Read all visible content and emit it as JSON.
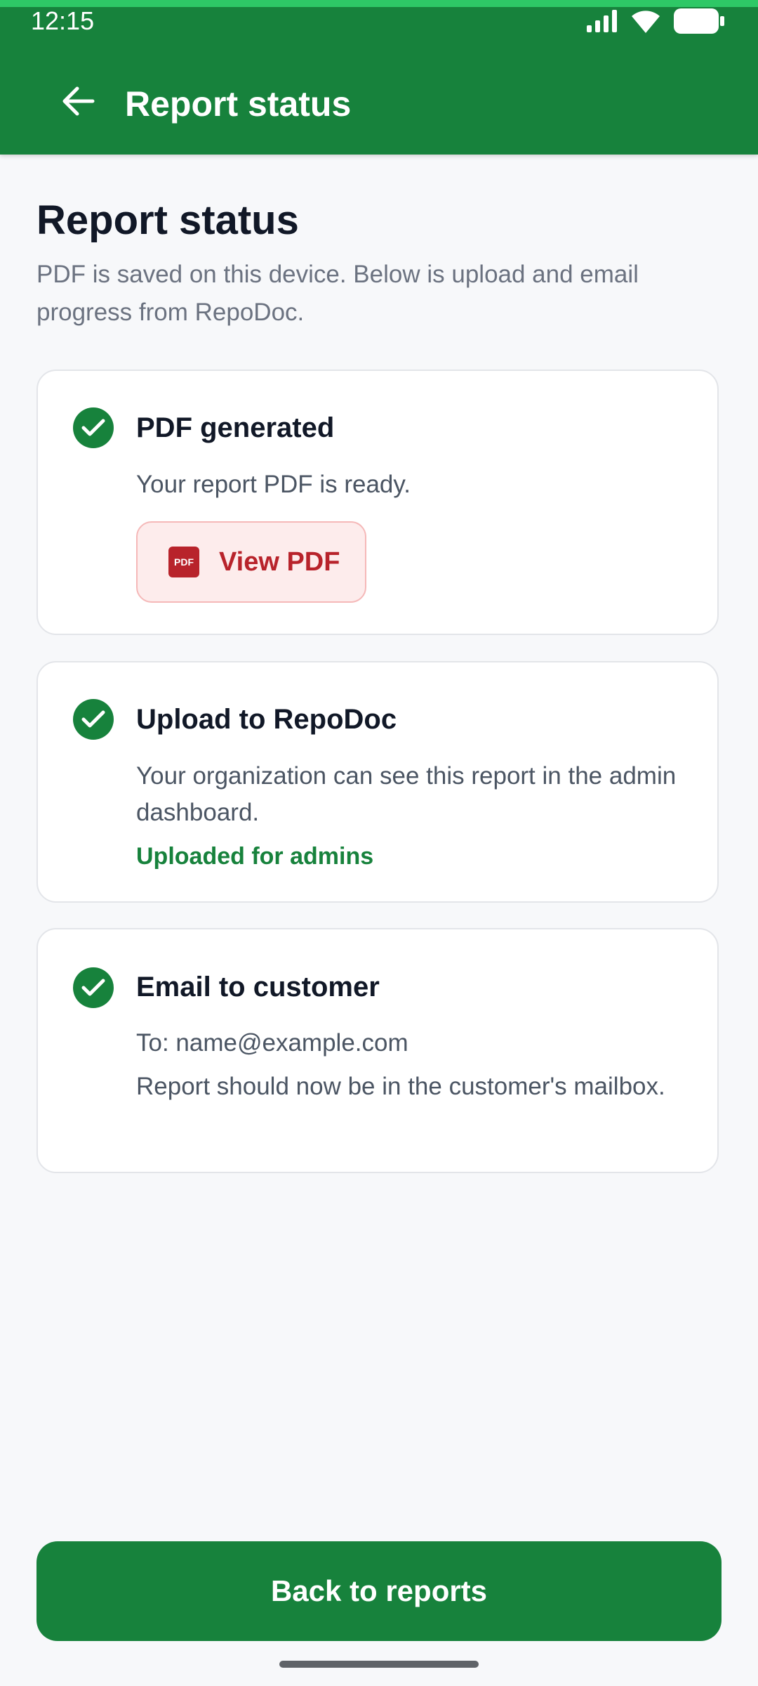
{
  "status_bar": {
    "time": "12:15",
    "icons": [
      "signal-icon",
      "wifi-icon",
      "battery-icon"
    ]
  },
  "app_bar": {
    "back_icon": "arrow-left-icon",
    "title": "Report status"
  },
  "page": {
    "title": "Report status",
    "subtitle": "PDF is saved on this device. Below is upload and email progress from RepoDoc."
  },
  "steps": [
    {
      "icon": "check-circle-icon",
      "title": "PDF generated",
      "text": "Your report PDF is ready.",
      "action": {
        "icon": "pdf-file-icon",
        "icon_text": "PDF",
        "label": "View PDF"
      }
    },
    {
      "icon": "check-circle-icon",
      "title": "Upload to RepoDoc",
      "text": "Your organization can see this report in the admin dashboard.",
      "status": "Uploaded for admins"
    },
    {
      "icon": "check-circle-icon",
      "title": "Email to customer",
      "recipient": "To: name@example.com",
      "text": "Report should now be in the customer's mailbox."
    }
  ],
  "footer": {
    "primary_button": "Back to reports"
  },
  "colors": {
    "brand_green": "#17823c",
    "pdf_red": "#b8232b",
    "background": "#f7f8fa"
  }
}
